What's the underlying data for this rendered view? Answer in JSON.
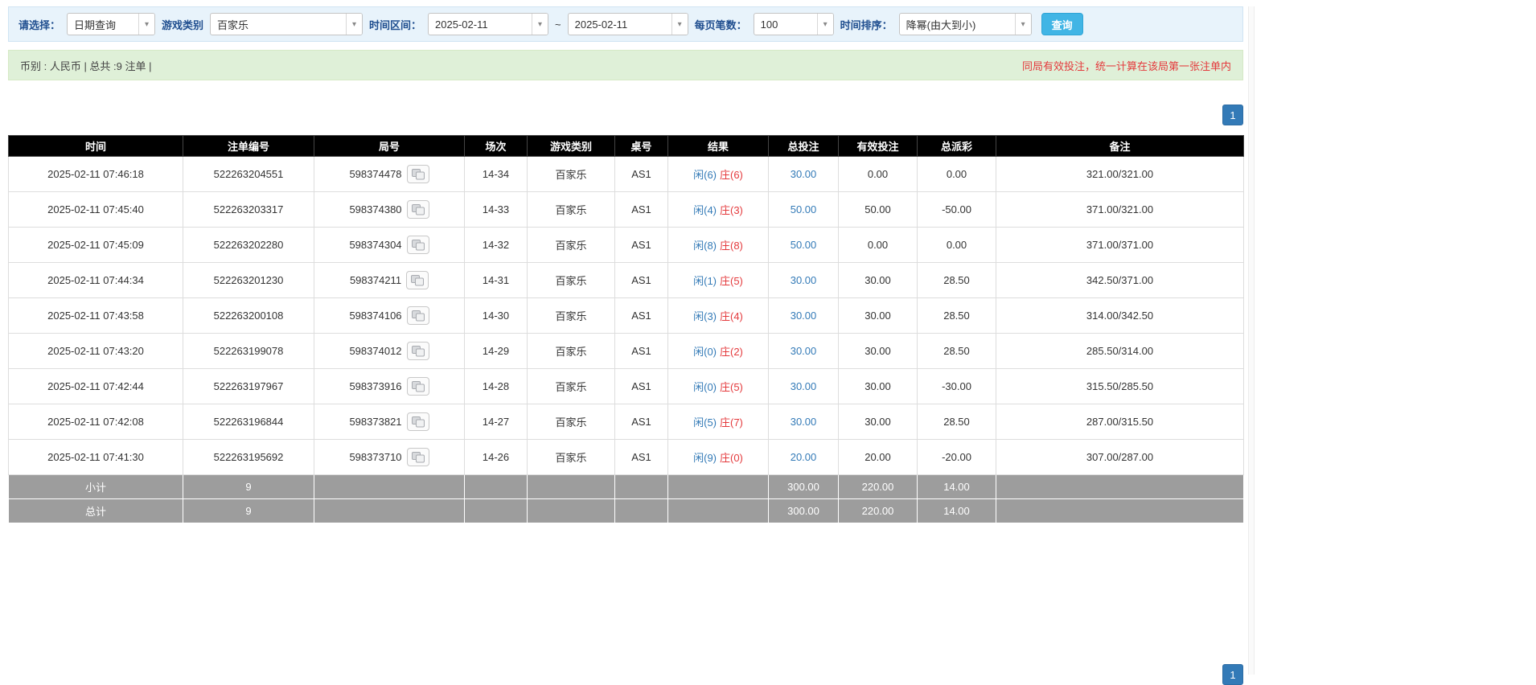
{
  "icons": {
    "dropdown_arrow": "▾"
  },
  "filter": {
    "select_label": "请选择：",
    "query_type": "日期查询",
    "game_label": "游戏类别",
    "game_type": "百家乐",
    "range_label": "时间区间：",
    "date_from": "2025-02-11",
    "range_separator": "~",
    "date_to": "2025-02-11",
    "page_size_label": "每页笔数：",
    "page_size": "100",
    "sort_label": "时间排序：",
    "sort_value": "降幂(由大到小)",
    "search_button": "查询"
  },
  "summary": {
    "info": "币别 : 人民币 | 总共 :9 注单 |",
    "notice": "同局有效投注，统一计算在该局第一张注单内"
  },
  "pagination": {
    "page": "1"
  },
  "table": {
    "headers": [
      "时间",
      "注单编号",
      "局号",
      "场次",
      "游戏类别",
      "桌号",
      "结果",
      "总投注",
      "有效投注",
      "总派彩",
      "备注"
    ],
    "rows": [
      {
        "time": "2025-02-11 07:46:18",
        "bet_id": "522263204551",
        "round": "598374478",
        "session": "14-34",
        "game": "百家乐",
        "table_no": "AS1",
        "player": "闲(6)",
        "banker": "庄(6)",
        "total_bet": "30.00",
        "valid_bet": "0.00",
        "payout": "0.00",
        "remark": "321.00/321.00"
      },
      {
        "time": "2025-02-11 07:45:40",
        "bet_id": "522263203317",
        "round": "598374380",
        "session": "14-33",
        "game": "百家乐",
        "table_no": "AS1",
        "player": "闲(4)",
        "banker": "庄(3)",
        "total_bet": "50.00",
        "valid_bet": "50.00",
        "payout": "-50.00",
        "remark": "371.00/321.00"
      },
      {
        "time": "2025-02-11 07:45:09",
        "bet_id": "522263202280",
        "round": "598374304",
        "session": "14-32",
        "game": "百家乐",
        "table_no": "AS1",
        "player": "闲(8)",
        "banker": "庄(8)",
        "total_bet": "50.00",
        "valid_bet": "0.00",
        "payout": "0.00",
        "remark": "371.00/371.00"
      },
      {
        "time": "2025-02-11 07:44:34",
        "bet_id": "522263201230",
        "round": "598374211",
        "session": "14-31",
        "game": "百家乐",
        "table_no": "AS1",
        "player": "闲(1)",
        "banker": "庄(5)",
        "total_bet": "30.00",
        "valid_bet": "30.00",
        "payout": "28.50",
        "remark": "342.50/371.00"
      },
      {
        "time": "2025-02-11 07:43:58",
        "bet_id": "522263200108",
        "round": "598374106",
        "session": "14-30",
        "game": "百家乐",
        "table_no": "AS1",
        "player": "闲(3)",
        "banker": "庄(4)",
        "total_bet": "30.00",
        "valid_bet": "30.00",
        "payout": "28.50",
        "remark": "314.00/342.50"
      },
      {
        "time": "2025-02-11 07:43:20",
        "bet_id": "522263199078",
        "round": "598374012",
        "session": "14-29",
        "game": "百家乐",
        "table_no": "AS1",
        "player": "闲(0)",
        "banker": "庄(2)",
        "total_bet": "30.00",
        "valid_bet": "30.00",
        "payout": "28.50",
        "remark": "285.50/314.00"
      },
      {
        "time": "2025-02-11 07:42:44",
        "bet_id": "522263197967",
        "round": "598373916",
        "session": "14-28",
        "game": "百家乐",
        "table_no": "AS1",
        "player": "闲(0)",
        "banker": "庄(5)",
        "total_bet": "30.00",
        "valid_bet": "30.00",
        "payout": "-30.00",
        "remark": "315.50/285.50"
      },
      {
        "time": "2025-02-11 07:42:08",
        "bet_id": "522263196844",
        "round": "598373821",
        "session": "14-27",
        "game": "百家乐",
        "table_no": "AS1",
        "player": "闲(5)",
        "banker": "庄(7)",
        "total_bet": "30.00",
        "valid_bet": "30.00",
        "payout": "28.50",
        "remark": "287.00/315.50"
      },
      {
        "time": "2025-02-11 07:41:30",
        "bet_id": "522263195692",
        "round": "598373710",
        "session": "14-26",
        "game": "百家乐",
        "table_no": "AS1",
        "player": "闲(9)",
        "banker": "庄(0)",
        "total_bet": "20.00",
        "valid_bet": "20.00",
        "payout": "-20.00",
        "remark": "307.00/287.00"
      }
    ],
    "subtotal": {
      "label": "小计",
      "count": "9",
      "total_bet": "300.00",
      "valid_bet": "220.00",
      "payout": "14.00"
    },
    "total": {
      "label": "总计",
      "count": "9",
      "total_bet": "300.00",
      "valid_bet": "220.00",
      "payout": "14.00"
    }
  },
  "colors": {
    "accent_blue": "#337ab7",
    "negative_red": "#e4393c",
    "header_bg": "#000000",
    "footer_bg": "#9d9d9d",
    "filter_bg": "#e8f3fb",
    "summary_bg": "#dff0d8",
    "search_button_cyan": "#41b5e5"
  }
}
